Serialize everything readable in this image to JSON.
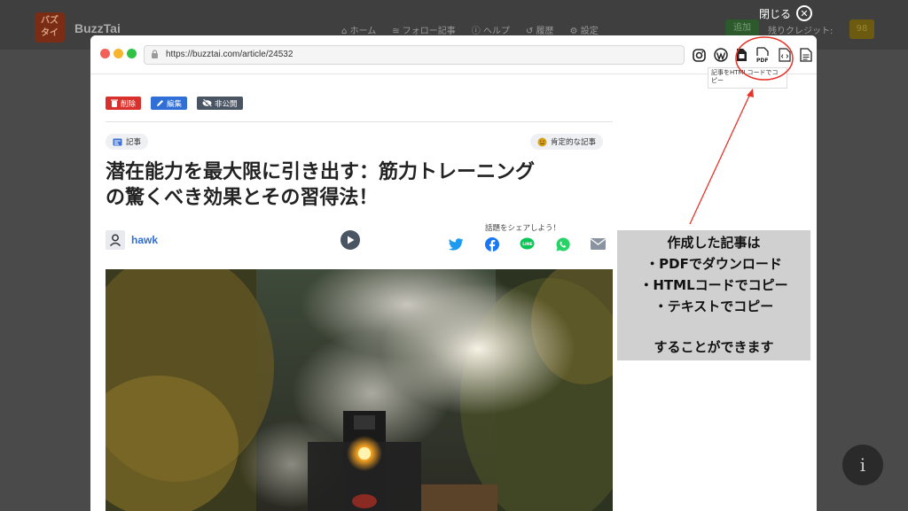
{
  "background_app": {
    "logo_text_1": "バズ",
    "logo_text_2": "タイ",
    "brand": "BuzzTai",
    "nav": [
      {
        "icon": "home-icon",
        "label": "ホーム"
      },
      {
        "icon": "rss-icon",
        "label": "フォロー記事"
      },
      {
        "icon": "help-icon",
        "label": "ヘルプ"
      },
      {
        "icon": "history-icon",
        "label": "履歴"
      },
      {
        "icon": "gear-icon",
        "label": "設定"
      }
    ],
    "green_button": "追加",
    "credit_label": "残りクレジット:",
    "credit_value": "98"
  },
  "close": {
    "label": "閉じる"
  },
  "browser": {
    "url": "https://buzztai.com/article/24532",
    "toolbar_icons": [
      "instagram-icon",
      "wordpress-icon",
      "file-download-icon",
      "pdf-icon",
      "html-code-icon",
      "text-file-icon"
    ],
    "tooltip": "記事をHTMLコードでコピー"
  },
  "article": {
    "actions": {
      "delete": "削除",
      "edit": "編集",
      "private": "非公開"
    },
    "category": "記事",
    "tone": "肯定的な記事",
    "title_line1": "潜在能力を最大限に引き出す：筋力トレーニング",
    "title_line2": "の驚くべき効果とその習得法！",
    "author": "hawk",
    "share_label": "話題をシェアしよう！",
    "share_icons": [
      "twitter-icon",
      "facebook-icon",
      "line-icon",
      "whatsapp-icon",
      "mail-icon"
    ]
  },
  "annotation": {
    "line1": "作成した記事は",
    "line2": "・PDFでダウンロード",
    "line3": "・HTMLコードでコピー",
    "line4": "・テキストでコピー",
    "line5": "することができます"
  },
  "colors": {
    "accent_red": "#e8332a",
    "link_blue": "#2f6fd6"
  }
}
